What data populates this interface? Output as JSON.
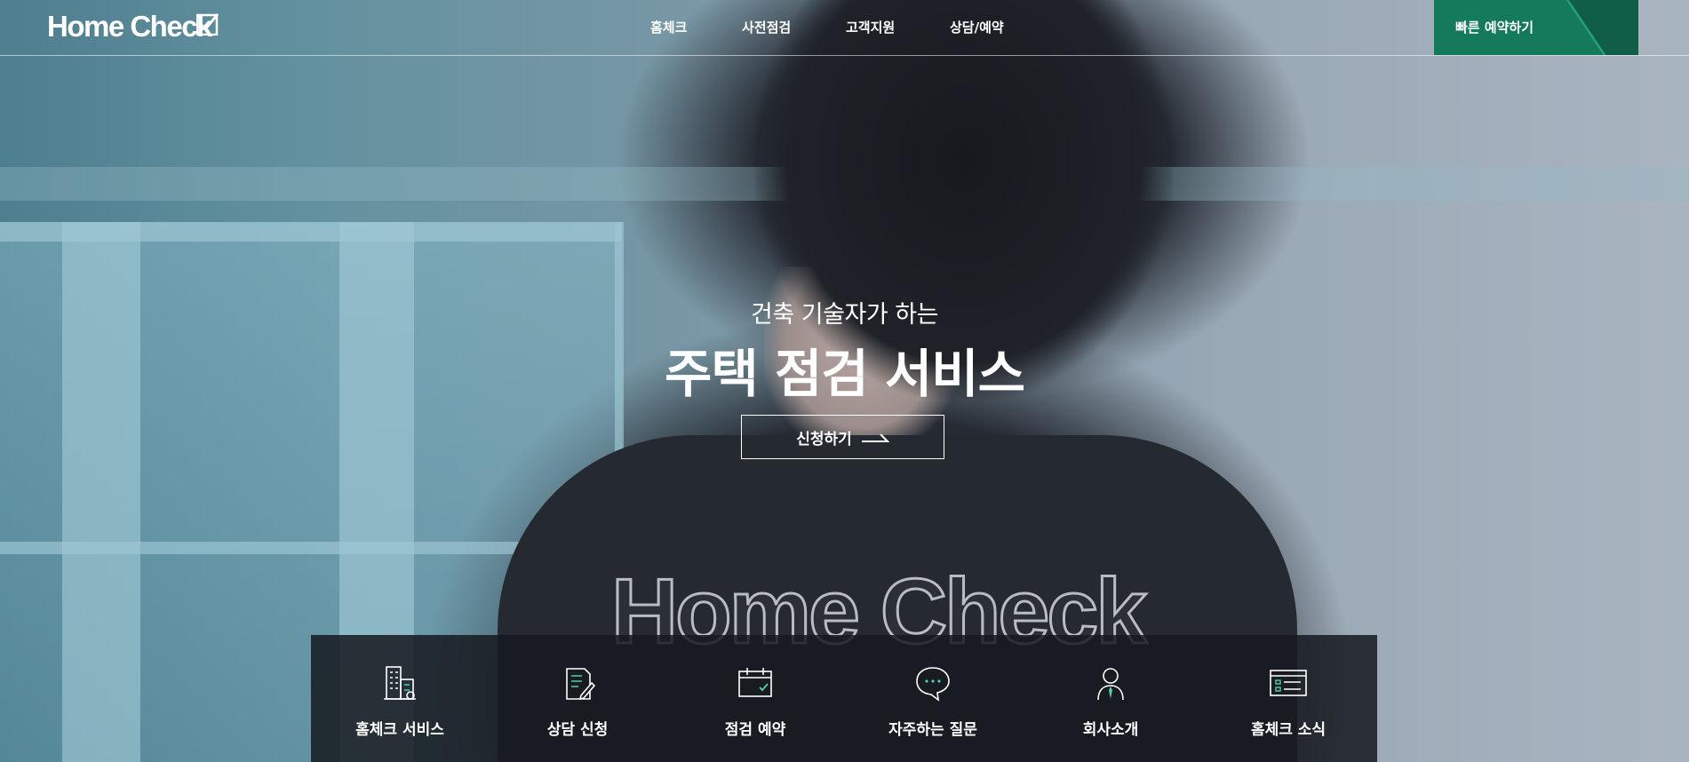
{
  "header": {
    "logo": "Home Check",
    "nav": [
      {
        "label": "홈체크"
      },
      {
        "label": "사전점검"
      },
      {
        "label": "고객지원"
      },
      {
        "label": "상담/예약"
      }
    ],
    "quick_reserve_label": "빠른 예약하기"
  },
  "hero": {
    "subtitle": "건축 기술자가 하는",
    "title": "주택 점검 서비스",
    "apply_label": "신청하기",
    "background_logo": "Home Check"
  },
  "quick_menu": [
    {
      "label": "홈체크 서비스",
      "icon": "buildings-icon"
    },
    {
      "label": "상담 신청",
      "icon": "document-pen-icon"
    },
    {
      "label": "점검 예약",
      "icon": "calendar-check-icon"
    },
    {
      "label": "자주하는 질문",
      "icon": "chat-bubble-icon"
    },
    {
      "label": "회사소개",
      "icon": "person-icon"
    },
    {
      "label": "홈체크 소식",
      "icon": "news-icon"
    }
  ],
  "colors": {
    "accent_green": "#147a5a",
    "icon_mint": "#4fd0a5"
  }
}
